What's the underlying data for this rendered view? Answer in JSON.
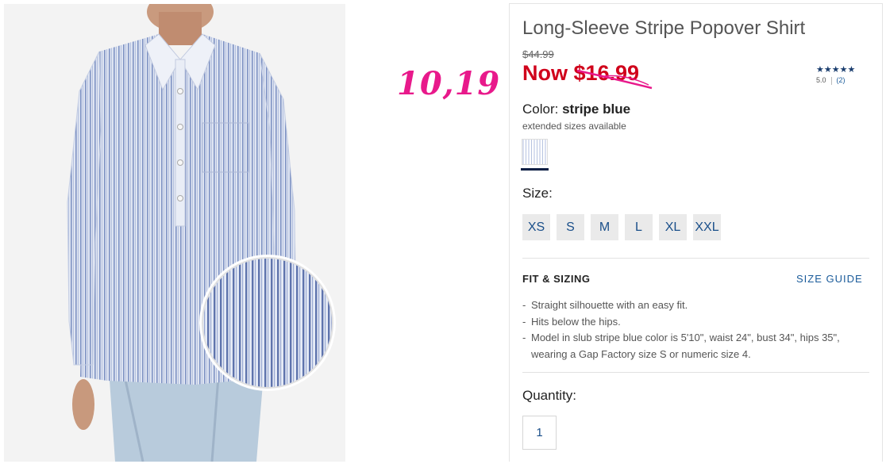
{
  "product": {
    "title": "Long-Sleeve Stripe Popover Shirt",
    "original_price": "$44.99",
    "sale_price": "Now $16.99",
    "handwritten_price": "10,19",
    "rating": {
      "stars": "★★★★★",
      "score": "5.0",
      "count": "(2)"
    }
  },
  "color": {
    "label": "Color:",
    "value": "stripe blue",
    "note": "extended sizes available",
    "swatch_icon": "stripe-swatch"
  },
  "size": {
    "label": "Size:",
    "options": [
      "XS",
      "S",
      "M",
      "L",
      "XL",
      "XXL"
    ]
  },
  "fit": {
    "heading": "FIT & SIZING",
    "guide_link": "SIZE GUIDE",
    "items": [
      "Straight silhouette with an easy fit.",
      "Hits below the hips.",
      "Model in slub stripe blue color is 5'10\", waist 24\", bust 34\", hips 35\", wearing a Gap Factory size S or numeric size 4."
    ]
  },
  "quantity": {
    "label": "Quantity:",
    "value": "1"
  },
  "colors": {
    "sale_red": "#d0021b",
    "handwriting_pink": "#e8198b",
    "link_blue": "#1a5b9a",
    "navy": "#0c1f44"
  }
}
